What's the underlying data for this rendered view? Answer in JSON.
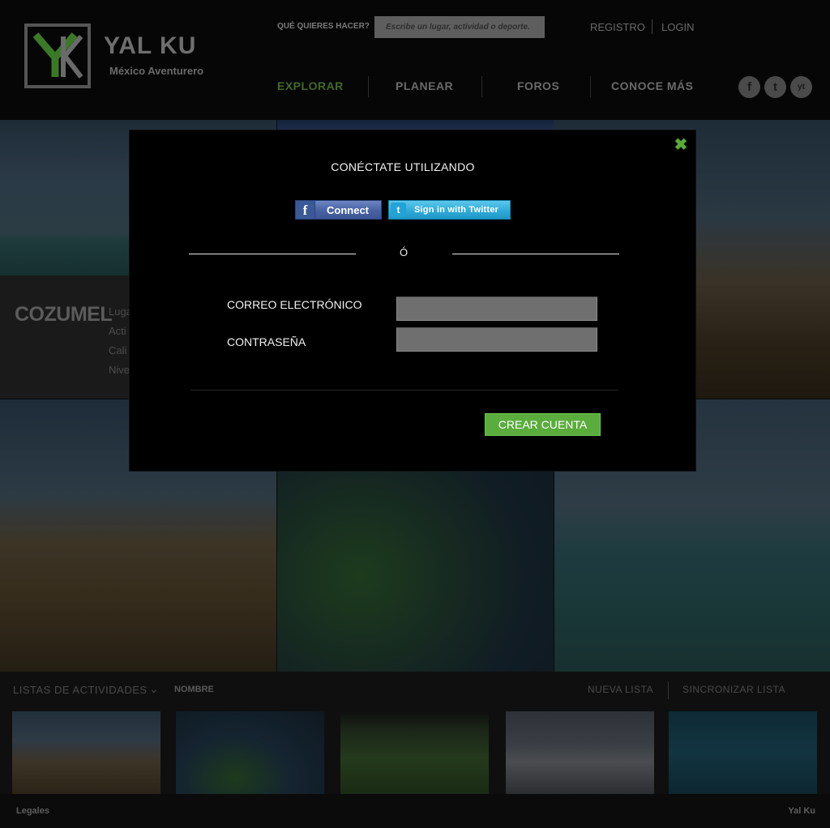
{
  "header": {
    "brand_name": "YAL KU",
    "brand_tagline": "México Aventurero",
    "search_label": "QUÉ QUIERES HACER?",
    "search_placeholder": "Escribe un lugar, actividad o deporte.",
    "registro": "REGISTRO",
    "login": "LOGIN",
    "nav": [
      "EXPLORAR",
      "PLANEAR",
      "FOROS",
      "CONOCE MÁS"
    ],
    "social": [
      "f",
      "t",
      "yt"
    ]
  },
  "feature": {
    "title": "COZUMEL",
    "info": [
      "Luga",
      "Acti",
      "Cali",
      "Nive"
    ]
  },
  "lists": {
    "title": "LISTAS DE ACTIVIDADES",
    "sort": "NOMBRE",
    "new_list": "NUEVA LISTA",
    "sync_list": "SINCRONIZAR LISTA"
  },
  "footer": {
    "legal": "Legales",
    "brand": "Yal Ku"
  },
  "modal": {
    "title": "CONÉCTATE UTILIZANDO",
    "facebook_label": "Connect",
    "twitter_label": "Sign in with Twitter",
    "or_text": "Ó",
    "email_label": "CORREO ELECTRÓNICO",
    "email_value": "",
    "password_label": "CONTRASEÑA",
    "password_value": "",
    "create_label": "CREAR CUENTA"
  },
  "colors": {
    "accent_green": "#5aac3d",
    "nav_active": "#3f6a27",
    "facebook_blue": "#3b5998",
    "twitter_blue": "#33aedb"
  }
}
